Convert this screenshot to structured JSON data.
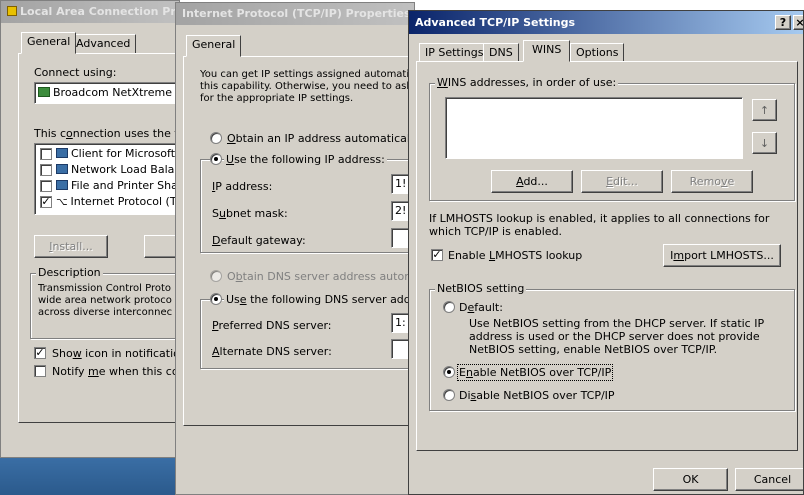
{
  "win1": {
    "title": "Local Area Connection Pr",
    "tabs": [
      "General",
      "Advanced"
    ],
    "connect_using_label": "Connect using:",
    "adapter_name": "Broadcom NetXtreme (",
    "items_label": "This connection uses the follo",
    "items": [
      {
        "label": "Client for Microsoft N",
        "checked": false
      },
      {
        "label": "Network Load Balan",
        "checked": false
      },
      {
        "label": "File and Printer Shar",
        "checked": false
      },
      {
        "label": "Internet Protocol (TC",
        "checked": true
      }
    ],
    "install_label": "Install...",
    "description_label": "Description",
    "description_text": "Transmission Control Proto wide area network protoco across diverse interconnec",
    "show_icon_label": "Show icon in notification a",
    "show_icon_checked": true,
    "notify_label": "Notify me when this conn",
    "notify_checked": false
  },
  "win2": {
    "title": "Internet Protocol (TCP/IP) Properties",
    "tab": "General",
    "intro_text": "You can get IP settings assigned automatic this capability. Otherwise, you need to ask for the appropriate IP settings.",
    "obtain_ip_label": "Obtain an IP address automatically",
    "use_ip_label": "Use the following IP address:",
    "ip_label": "IP address:",
    "ip_value": "1!",
    "subnet_label": "Subnet mask:",
    "subnet_value": "2!",
    "gateway_label": "Default gateway:",
    "obtain_dns_label": "Obtain DNS server address automatic",
    "use_dns_label": "Use the following DNS server address",
    "preferred_dns_label": "Preferred DNS server:",
    "preferred_dns_value": "1:",
    "alternate_dns_label": "Alternate DNS server:"
  },
  "win3": {
    "title": "Advanced TCP/IP Settings",
    "help_button": "?",
    "close_button": "×",
    "tabs": [
      "IP Settings",
      "DNS",
      "WINS",
      "Options"
    ],
    "selected_tab": "WINS",
    "wins_label": "WINS addresses, in order of use:",
    "add_label": "Add...",
    "edit_label": "Edit...",
    "remove_label": "Remove",
    "lmhosts_info": "If LMHOSTS lookup is enabled, it applies to all connections for which TCP/IP is enabled.",
    "enable_lmhosts_label": "Enable LMHOSTS lookup",
    "enable_lmhosts_checked": true,
    "import_lmhosts_label": "Import LMHOSTS...",
    "netbios_group_label": "NetBIOS setting",
    "default_label": "Default:",
    "default_desc": "Use NetBIOS setting from the DHCP server. If static IP address is used or the DHCP server does not provide NetBIOS setting, enable NetBIOS over TCP/IP.",
    "enable_netbios_label": "Enable NetBIOS over TCP/IP",
    "disable_netbios_label": "Disable NetBIOS over TCP/IP",
    "netbios_selected": "enable",
    "ok_label": "OK",
    "cancel_label": "Cancel"
  },
  "colors": {
    "dialog_bg": "#d4d0c8",
    "active_title": "#0a246a",
    "inactive_title": "#a3a3a3",
    "taskbar": "#3a6ea5"
  }
}
